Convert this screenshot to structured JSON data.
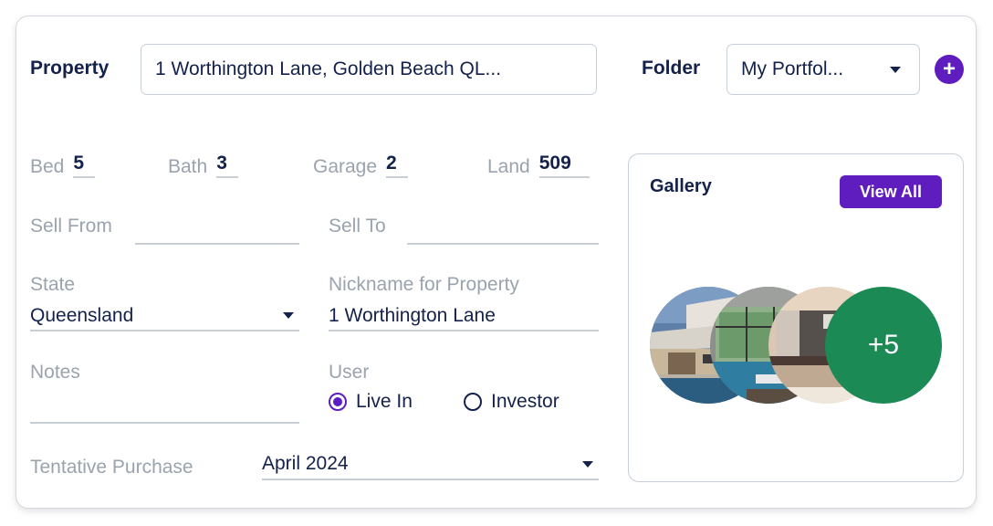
{
  "header": {
    "property_label": "Property",
    "property_value": "1 Worthington Lane, Golden Beach QL...",
    "folder_label": "Folder",
    "folder_value": "My Portfol...",
    "add_folder_icon": "plus-icon"
  },
  "stats": {
    "bed": {
      "label": "Bed",
      "value": "5"
    },
    "bath": {
      "label": "Bath",
      "value": "3"
    },
    "garage": {
      "label": "Garage",
      "value": "2"
    },
    "land": {
      "label": "Land",
      "value": "509"
    }
  },
  "fields": {
    "sell_from": {
      "label": "Sell From",
      "value": ""
    },
    "sell_to": {
      "label": "Sell To",
      "value": ""
    },
    "state": {
      "label": "State",
      "value": "Queensland"
    },
    "nickname": {
      "label": "Nickname for Property",
      "value": "1 Worthington Lane"
    },
    "notes": {
      "label": "Notes",
      "value": ""
    },
    "user": {
      "label": "User",
      "options": [
        {
          "label": "Live In",
          "selected": true
        },
        {
          "label": "Investor",
          "selected": false
        }
      ]
    },
    "tentative_purchase": {
      "label": "Tentative Purchase",
      "value": "April 2024"
    }
  },
  "gallery": {
    "title": "Gallery",
    "view_all_label": "View All",
    "thumbnails": [
      "house-exterior-pool",
      "indoor-pool",
      "kitchen"
    ],
    "more_count": "+5",
    "more_color": "#1b8a55"
  },
  "colors": {
    "accent": "#5f1dbf",
    "text": "#14214a",
    "muted": "#9aa3ae"
  }
}
